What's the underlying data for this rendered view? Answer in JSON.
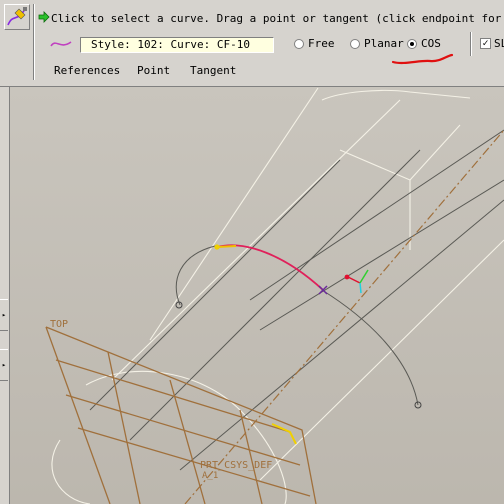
{
  "prompt": "Click to select a curve.  Drag a point or tangent (click endpoint for tangent",
  "style_field": "Style: 102: Curve:   CF-10",
  "curve_modes": [
    "Free",
    "Planar",
    "COS"
  ],
  "selected_mode": "COS",
  "sl_checkbox_label": "SL",
  "tabs": [
    "References",
    "Point",
    "Tangent"
  ],
  "viewport": {
    "plane_label": "TOP",
    "csys_label": "PRT_CSYS_DEF",
    "csys_sub": "A_1"
  },
  "colors": {
    "toolbar_bg": "#d6d3ce",
    "field_bg": "#ffffe0",
    "curve_red": "#e0205a",
    "annotation_red": "#e01010",
    "datum_brown": "#a0703c"
  }
}
